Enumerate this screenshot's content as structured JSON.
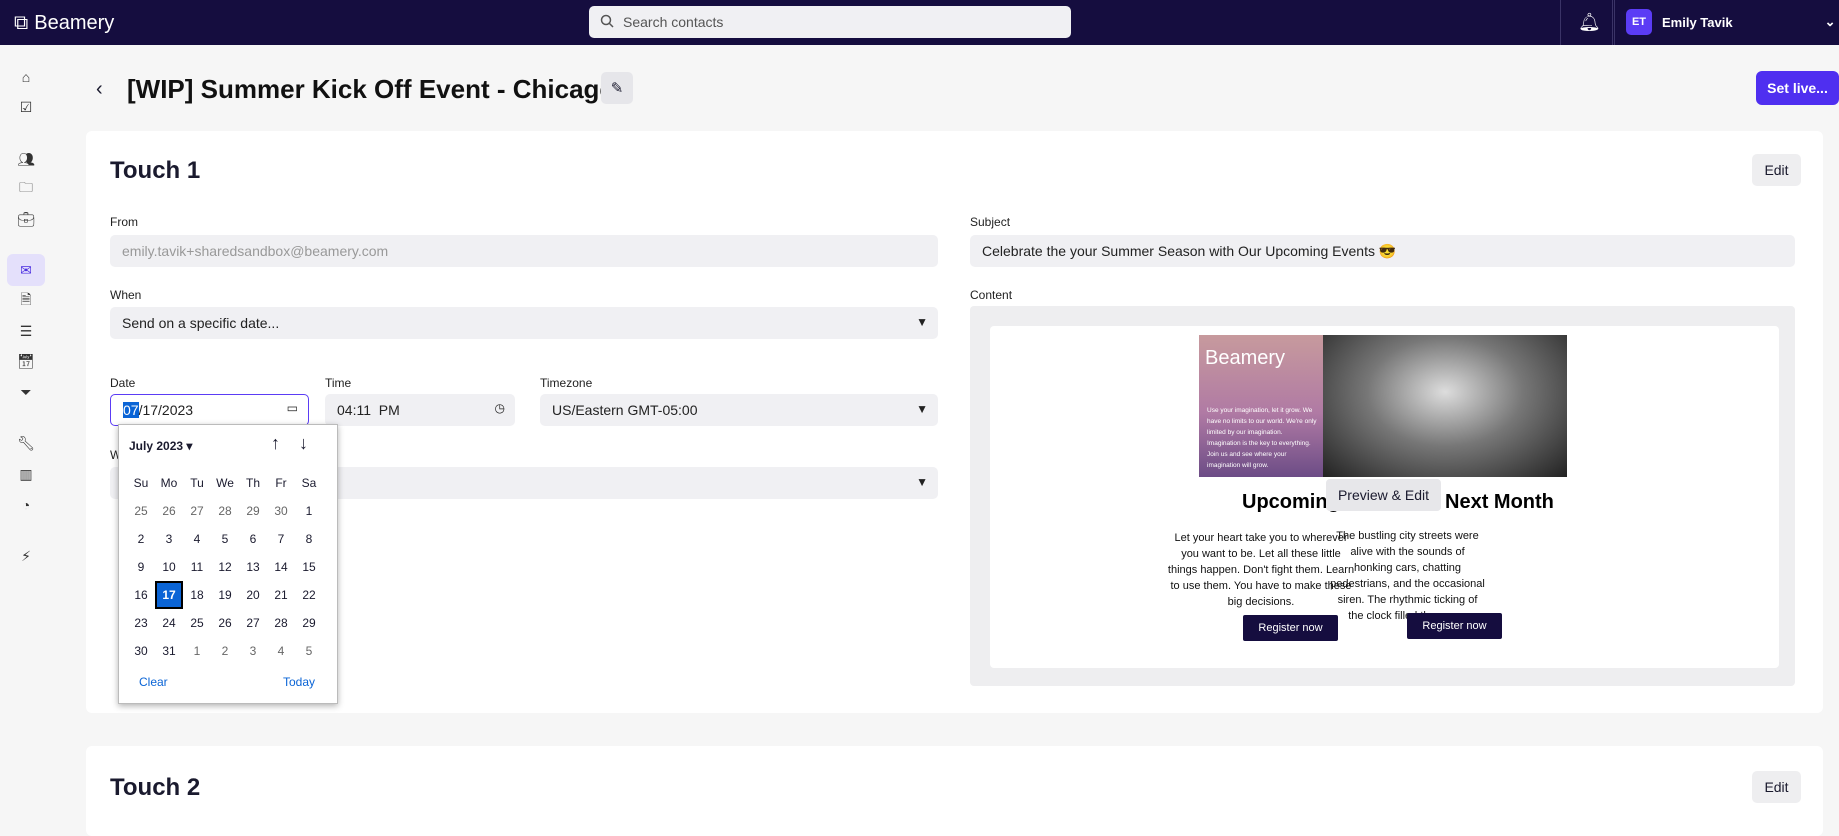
{
  "topbar": {
    "brand": "Beamery",
    "search_placeholder": "Search contacts",
    "user_initials": "ET",
    "user_name": "Emily Tavik"
  },
  "page": {
    "title": "[WIP] Summer Kick Off Event - Chicago",
    "set_live": "Set live..."
  },
  "touch1": {
    "title": "Touch 1",
    "edit": "Edit",
    "from_label": "From",
    "from_value": "emily.tavik+sharedsandbox@beamery.com",
    "when_label": "When",
    "when_value": "Send on a specific date...",
    "date_label": "Date",
    "date_month": "07",
    "date_rest": "/17/2023",
    "time_label": "Time",
    "time_value": "04:11  PM",
    "tz_label": "Timezone",
    "tz_value": "US/Eastern GMT-05:00",
    "hidden_label": "W",
    "subject_label": "Subject",
    "subject_value": "Celebrate the your Summer Season with Our Upcoming Events 😎",
    "content_label": "Content"
  },
  "email": {
    "brand": "Beamery",
    "hero_text": "Use your imagination, let it grow. We have no limits to our world. We're only limited by our imagination. Imagination is the key to everything. Join us and see where your imagination will grow.",
    "heading_left": "Upcoming",
    "heading_right": "Next Month",
    "preview_edit": "Preview & Edit",
    "col1": "Let your heart take you to wherever you want to be. Let all these little things happen. Don't fight them. Learn to use them. You have to make these big decisions.",
    "col2": "The bustling city streets were alive with the sounds of honking cars, chatting pedestrians, and the occasional siren. The rhythmic ticking of the clock filled the room.",
    "register": "Register now"
  },
  "calendar": {
    "month": "July 2023",
    "weekdays": [
      "Su",
      "Mo",
      "Tu",
      "We",
      "Th",
      "Fr",
      "Sa"
    ],
    "days": [
      "25",
      "26",
      "27",
      "28",
      "29",
      "30",
      "1",
      "2",
      "3",
      "4",
      "5",
      "6",
      "7",
      "8",
      "9",
      "10",
      "11",
      "12",
      "13",
      "14",
      "15",
      "16",
      "17",
      "18",
      "19",
      "20",
      "21",
      "22",
      "23",
      "24",
      "25",
      "26",
      "27",
      "28",
      "29",
      "30",
      "31",
      "1",
      "2",
      "3",
      "4",
      "5"
    ],
    "selected": "17",
    "clear": "Clear",
    "today": "Today"
  },
  "touch2": {
    "title": "Touch 2",
    "edit": "Edit"
  }
}
